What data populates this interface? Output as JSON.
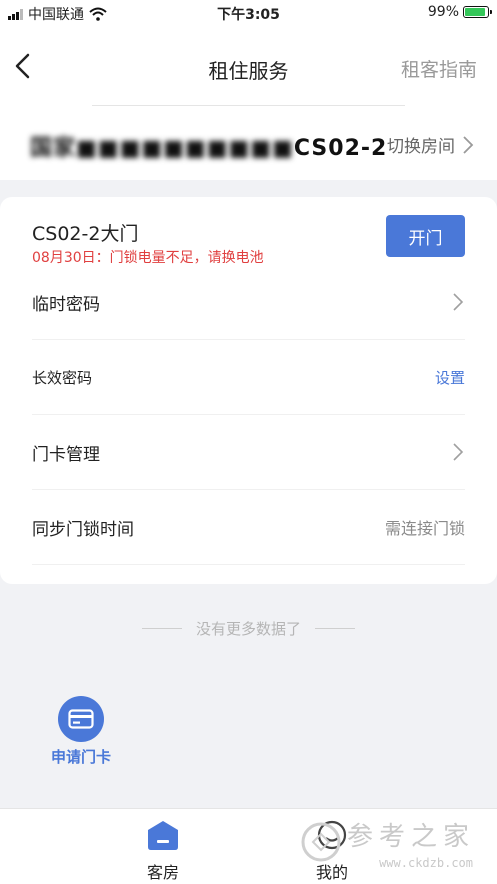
{
  "status_bar": {
    "carrier": "中国联通",
    "time": "下午3:05",
    "battery": "99%"
  },
  "nav": {
    "title": "租住服务",
    "right_link": "租客指南"
  },
  "room": {
    "name_obscured": "国家■■■■■■■■■■",
    "name_suffix": "CS02-2",
    "switch_label": "切换房间"
  },
  "door": {
    "title": "CS02-2大门",
    "alert": "08月30日：门锁电量不足，请换电池",
    "open_label": "开门"
  },
  "rows": [
    {
      "label": "临时密码"
    },
    {
      "label": "长效密码",
      "value": "设置"
    },
    {
      "label": "门卡管理"
    },
    {
      "label": "同步门锁时间",
      "value": "需连接门锁"
    }
  ],
  "no_more": "没有更多数据了",
  "apply_card": {
    "label": "申请门卡"
  },
  "tabs": [
    {
      "label": "客房",
      "icon": "house-icon",
      "active": true
    },
    {
      "label": "我的",
      "icon": "profile-icon",
      "active": false
    }
  ],
  "watermark": {
    "cn": "参考之家",
    "url": "www.ckdzb.com"
  },
  "colors": {
    "accent": "#4a78d8",
    "alert": "#e04040",
    "battery": "#34c759",
    "background": "#f1f2f5"
  }
}
